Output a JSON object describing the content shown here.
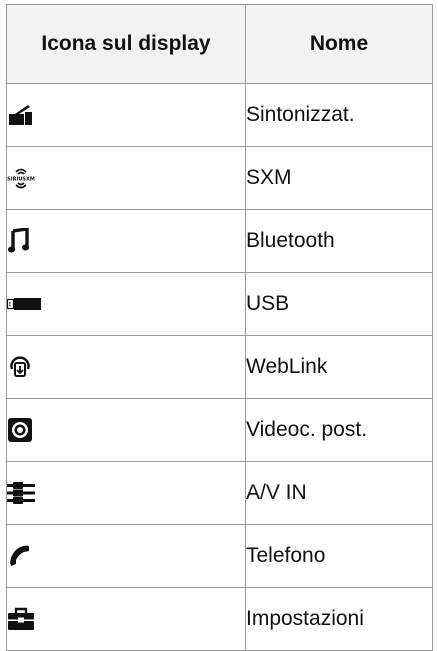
{
  "table": {
    "headers": {
      "icon": "Icona sul display",
      "name": "Nome"
    },
    "rows": [
      {
        "icon": "tuner-icon",
        "name": "Sintonizzat."
      },
      {
        "icon": "sxm-icon",
        "name": "SXM",
        "icon_text": "SIRIUSXM"
      },
      {
        "icon": "bluetooth-music-icon",
        "name": "Bluetooth"
      },
      {
        "icon": "usb-icon",
        "name": "USB"
      },
      {
        "icon": "weblink-icon",
        "name": "WebLink"
      },
      {
        "icon": "rear-camera-icon",
        "name": "Videoc. post."
      },
      {
        "icon": "av-in-icon",
        "name": "A/V IN"
      },
      {
        "icon": "phone-icon",
        "name": "Telefono"
      },
      {
        "icon": "settings-toolbox-icon",
        "name": "Impostazioni"
      }
    ]
  }
}
